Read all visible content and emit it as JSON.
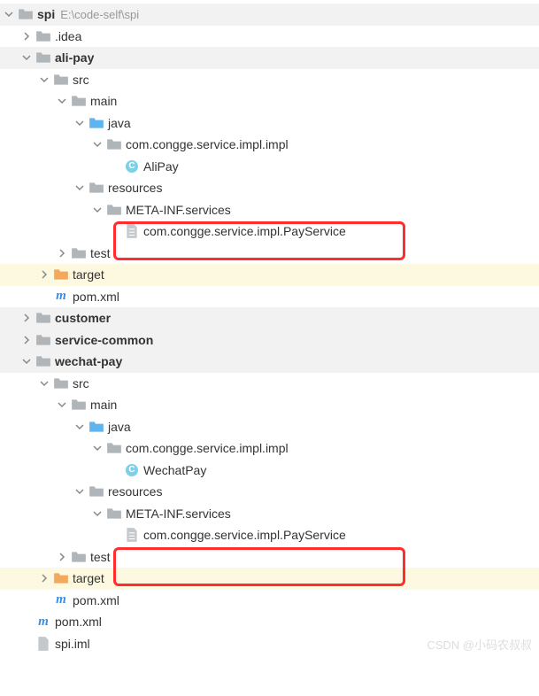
{
  "root": {
    "name": "spi",
    "path": "E:\\code-self\\spi"
  },
  "aliPay": {
    "module": "ali-pay",
    "package": "com.congge.service.impl.impl",
    "class": "AliPay",
    "serviceFile": "com.congge.service.impl.PayService",
    "metaInf": "META-INF.services"
  },
  "wechatPay": {
    "module": "wechat-pay",
    "package": "com.congge.service.impl.impl",
    "class": "WechatPay",
    "serviceFile": "com.congge.service.impl.PayService",
    "metaInf": "META-INF.services"
  },
  "folders": {
    "idea": ".idea",
    "src": "src",
    "main": "main",
    "java": "java",
    "resources": "resources",
    "test": "test",
    "target": "target",
    "customer": "customer",
    "serviceCommon": "service-common"
  },
  "files": {
    "pom": "pom.xml",
    "spiIml": "spi.iml"
  },
  "watermark": "CSDN @小码农叔叔"
}
